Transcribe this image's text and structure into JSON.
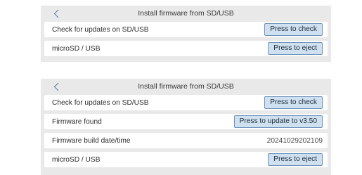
{
  "screen_a": {
    "title": "Install firmware from SD/USB",
    "back_icon": "chevron-left-icon",
    "rows": [
      {
        "label": "Check for updates on SD/USB",
        "button": "Press to check"
      },
      {
        "label": "microSD / USB",
        "button": "Press to eject"
      }
    ]
  },
  "screen_b": {
    "title": "Install firmware from SD/USB",
    "back_icon": "chevron-left-icon",
    "rows": [
      {
        "label": "Check for updates on SD/USB",
        "button": "Press to check"
      },
      {
        "label": "Firmware found",
        "button": "Press to update to v3.50"
      },
      {
        "label": "Firmware build date/time",
        "value": "20241029202109"
      },
      {
        "label": "microSD / USB",
        "button": "Press to eject"
      }
    ]
  },
  "colors": {
    "panel_bg": "#e9e9ea",
    "button_bg": "#cfe0f1",
    "button_border": "#6f92b8",
    "back_icon": "#5b7fa6"
  }
}
